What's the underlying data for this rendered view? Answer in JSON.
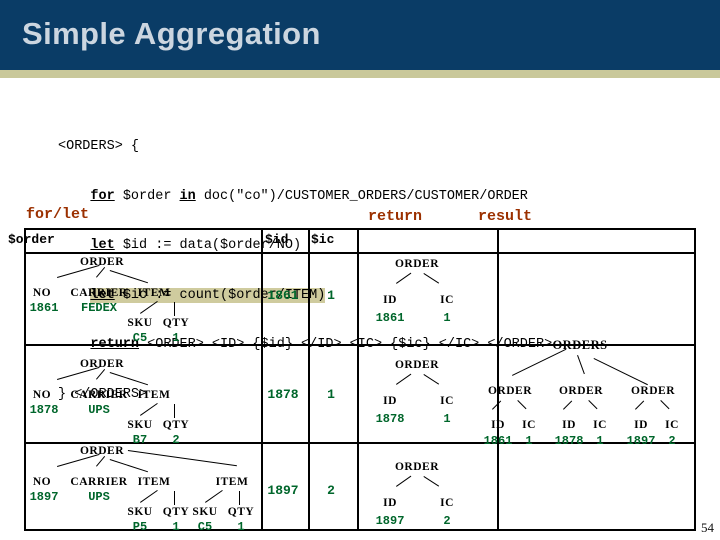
{
  "slide": {
    "title": "Simple Aggregation",
    "number": "54",
    "header_color": "#0a3c66",
    "accent_color": "#c9c89a",
    "title_color": "#ccd6e0",
    "caption_color": "#9b3000",
    "value_color": "#00662b",
    "highlight_color": "#cfcb9e"
  },
  "query": {
    "line1": "<ORDERS> {",
    "line2_kw1": "for",
    "line2_rest": " $order ",
    "line2_kw2": "in",
    "line2_tail": " doc(\"co\")/CUSTOMER_ORDERS/CUSTOMER/ORDER",
    "line3_kw": "let",
    "line3_rest": " $id := data($order/NO)",
    "line4_kw": "let",
    "line4_rest": " $ic := count($order/ITEM)",
    "line5_kw": "return",
    "line5_rest": " <ORDER> <ID> {$id} </ID> <IC> {$ic} </IC> </ORDER>",
    "line6": "} </ORDERS>"
  },
  "captions": {
    "forlet": "for/let",
    "return": "return",
    "result": "result"
  },
  "table": {
    "headers": {
      "order": "$order",
      "id": "$id",
      "ic": "$ic"
    },
    "rows": [
      {
        "order_tree": {
          "root": "ORDER",
          "children": [
            "NO",
            "CARRIER",
            "ITEM"
          ],
          "no_value": "1861",
          "carrier_value": "FEDEX",
          "items": [
            {
              "sku_label": "SKU",
              "qty_label": "QTY",
              "sku_value": "C5",
              "qty_value": "1"
            }
          ]
        },
        "id": "1861",
        "ic": "1",
        "return_tree": {
          "root": "ORDER",
          "id_label": "ID",
          "ic_label": "IC",
          "id_value": "1861",
          "ic_value": "1"
        }
      },
      {
        "order_tree": {
          "root": "ORDER",
          "children": [
            "NO",
            "CARRIER",
            "ITEM"
          ],
          "no_value": "1878",
          "carrier_value": "UPS",
          "items": [
            {
              "sku_label": "SKU",
              "qty_label": "QTY",
              "sku_value": "B7",
              "qty_value": "2"
            }
          ]
        },
        "id": "1878",
        "ic": "1",
        "return_tree": {
          "root": "ORDER",
          "id_label": "ID",
          "ic_label": "IC",
          "id_value": "1878",
          "ic_value": "1"
        }
      },
      {
        "order_tree": {
          "root": "ORDER",
          "children": [
            "NO",
            "CARRIER",
            "ITEM",
            "ITEM"
          ],
          "no_value": "1897",
          "carrier_value": "UPS",
          "items": [
            {
              "sku_label": "SKU",
              "qty_label": "QTY",
              "sku_value": "P5",
              "qty_value": "1"
            },
            {
              "sku_label": "SKU",
              "qty_label": "QTY",
              "sku_value": "C5",
              "qty_value": "1"
            }
          ]
        },
        "id": "1897",
        "ic": "2",
        "return_tree": {
          "root": "ORDER",
          "id_label": "ID",
          "ic_label": "IC",
          "id_value": "1897",
          "ic_value": "2"
        }
      }
    ],
    "result_tree": {
      "root": "ORDERS",
      "orders": [
        {
          "label": "ORDER",
          "id_label": "ID",
          "ic_label": "IC",
          "id_value": "1861",
          "ic_value": "1"
        },
        {
          "label": "ORDER",
          "id_label": "ID",
          "ic_label": "IC",
          "id_value": "1878",
          "ic_value": "1"
        },
        {
          "label": "ORDER",
          "id_label": "ID",
          "ic_label": "IC",
          "id_value": "1897",
          "ic_value": "2"
        }
      ]
    }
  }
}
